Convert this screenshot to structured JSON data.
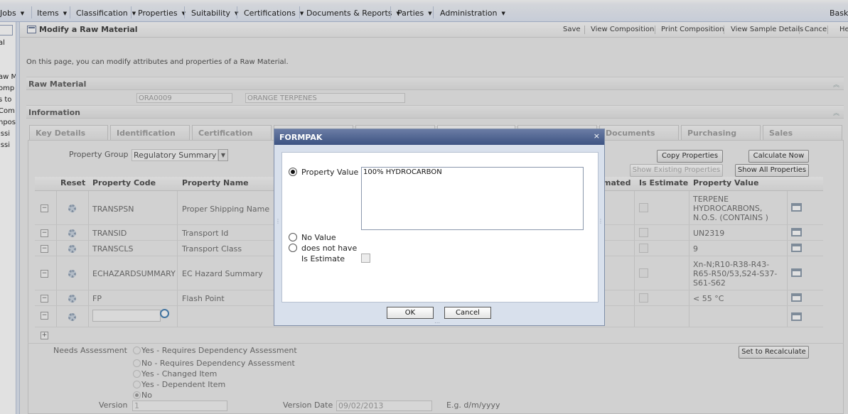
{
  "nav": {
    "items": [
      "Jobs",
      "Items",
      "Classification",
      "Properties",
      "Suitability",
      "Certifications",
      "Documents & Reports",
      "Parties",
      "Administration"
    ],
    "right_label": "Baske"
  },
  "left_panel": {
    "fragments": [
      "al",
      "aw M",
      "omp",
      "s to",
      "Com",
      "npos",
      "issi",
      "issi"
    ]
  },
  "page": {
    "title": "Modify a Raw Material",
    "actions": [
      "Save",
      "View Composition",
      "Print Composition",
      "View Sample Details",
      "Cancel",
      "He"
    ],
    "description": "On this page, you can modify attributes and properties of a Raw Material."
  },
  "raw_material": {
    "section_title": "Raw Material",
    "code": "ORA0009",
    "name": "ORANGE TERPENES"
  },
  "information": {
    "section_title": "Information",
    "tabs": [
      "Key Details",
      "Identification",
      "Certification",
      "",
      "",
      "",
      "",
      "Documents",
      "Purchasing",
      "Sales"
    ]
  },
  "properties": {
    "group_label": "Property Group",
    "group_value": "Regulatory Summary",
    "buttons": {
      "copy": "Copy Properties",
      "calculate": "Calculate Now",
      "show_existing": "Show Existing Properties",
      "show_all": "Show All Properties"
    },
    "columns": [
      "Reset",
      "Property Code",
      "Property Name",
      "mated",
      "Is Estimate",
      "Property Value"
    ],
    "rows": [
      {
        "code": "TRANSPSN",
        "name": "Proper Shipping Name",
        "value": "TERPENE HYDROCARBONS, N.O.S. (CONTAINS )"
      },
      {
        "code": "TRANSID",
        "name": "Transport Id",
        "value": "UN2319"
      },
      {
        "code": "TRANSCLS",
        "name": "Transport Class",
        "value": "9"
      },
      {
        "code": "ECHAZARDSUMMARY",
        "name": "EC Hazard Summary",
        "value": "Xn-N;R10-R38-R43-R65-R50/53,S24-S37-S61-S62"
      },
      {
        "code": "FP",
        "name": "Flash Point",
        "value": "< 55 °C"
      }
    ]
  },
  "assessment": {
    "label": "Needs Assessment",
    "options": [
      "Yes - Requires Dependency Assessment",
      "No - Requires Dependency Assessment",
      "Yes - Changed Item",
      "Yes - Dependent Item",
      "No"
    ],
    "recalc_button": "Set to Recalculate",
    "version_label": "Version",
    "version_value": "1",
    "version_date_label": "Version Date",
    "version_date_value": "09/02/2013",
    "date_hint": "E.g. d/m/yyyy"
  },
  "dialog": {
    "title": "FORMPAK",
    "close": "×",
    "property_value_label": "Property Value",
    "property_value": "100% HYDROCARBON",
    "no_value_label": "No Value",
    "does_not_have_label": "does not have",
    "is_estimate_label": "Is Estimate",
    "ok": "OK",
    "cancel": "Cancel"
  }
}
